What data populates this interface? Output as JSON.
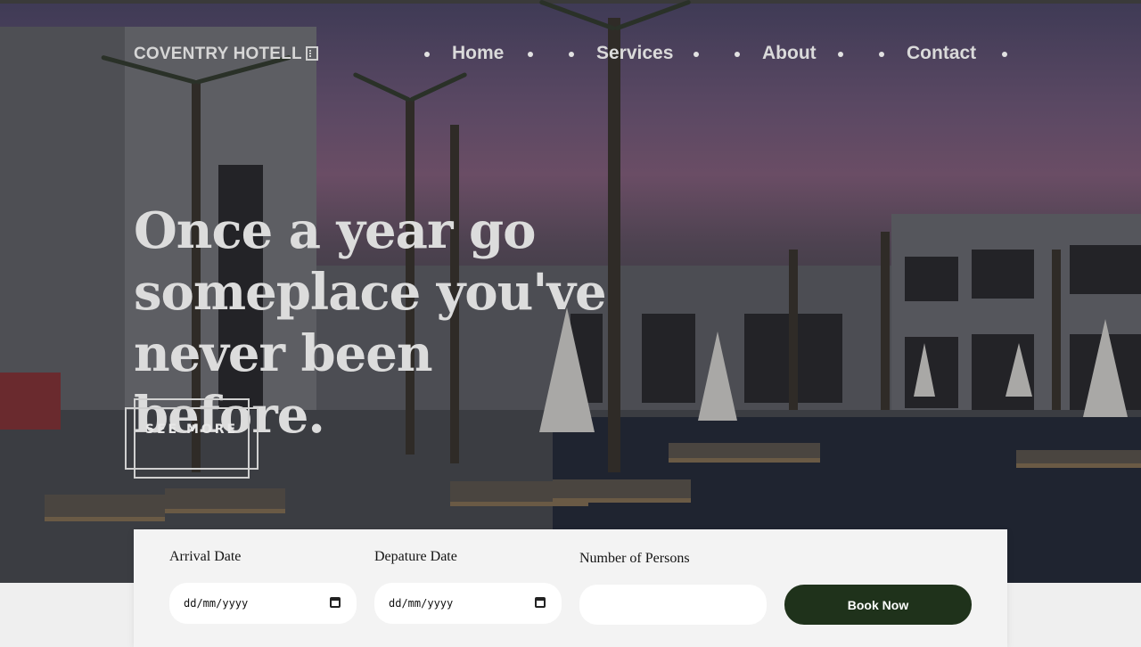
{
  "nav": {
    "logo": "COVENTRY HOTELL",
    "logo_icon": "building-icon",
    "items": [
      {
        "label": "Home"
      },
      {
        "label": "Services"
      },
      {
        "label": "About"
      },
      {
        "label": "Contact"
      }
    ]
  },
  "hero": {
    "headline": "Once a year go someplace you've never been before.",
    "cta_label": "SEE MORE"
  },
  "booking": {
    "arrival_label": "Arrival Date",
    "arrival_value": "dd/mm/yyyy",
    "departure_label": "Depature Date",
    "departure_value": "dd/mm/yyyy",
    "persons_label": "Number of Persons",
    "persons_value": "",
    "book_label": "Book Now",
    "calendar_icon": "calendar-icon"
  },
  "colors": {
    "book_button": "#1f321b",
    "panel": "#f3f3f3",
    "text_light": "#dcdcdc"
  }
}
